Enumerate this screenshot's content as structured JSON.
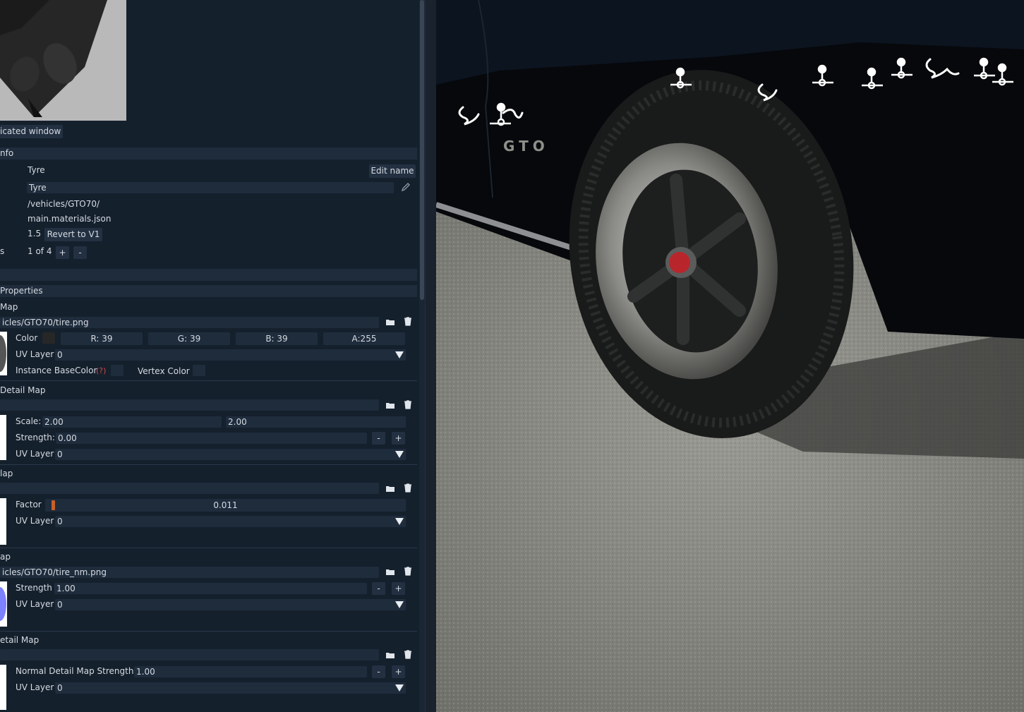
{
  "preview": {
    "window_label": "icated window"
  },
  "info": {
    "header": "nfo",
    "name_value": "Tyre",
    "edit_name_button": "Edit name",
    "name_input": "Tyre",
    "path": "/vehicles/GTO70/",
    "file": "main.materials.json",
    "version": "1.5",
    "revert_button": "Revert to V1",
    "stage_row_prefix": "s",
    "stage_count": "1 of 4",
    "stage_add": "+",
    "stage_remove": "-"
  },
  "properties": {
    "header": "Properties"
  },
  "base_color_map": {
    "header": " Map",
    "path": "icles/GTO70/tire.png",
    "color_label": "Color",
    "swatch_color": "#272727",
    "r": "R: 39",
    "g": "G: 39",
    "b": "B: 39",
    "a": "A:255",
    "uv_label": "UV Layer",
    "uv_value": "0",
    "instance_label": "Instance BaseColor",
    "help_mark": "(?)",
    "vertex_label": "Vertex Color"
  },
  "detail_map": {
    "header": " Detail Map",
    "path": "",
    "scale_label": "Scale:",
    "scale_x": "2.00",
    "scale_y": "2.00",
    "strength_label": "Strength:",
    "strength_value": "0.00",
    "minus": "-",
    "plus": "+",
    "uv_label": "UV Layer",
    "uv_value": "0"
  },
  "third_map": {
    "header": "lap",
    "path": "",
    "factor_label": "Factor",
    "factor_value": "0.011",
    "factor_level": 0.011,
    "uv_label": "UV Layer",
    "uv_value": "0"
  },
  "normal_map": {
    "header": "ap",
    "path": "icles/GTO70/tire_nm.png",
    "strength_label": "Strength",
    "strength_value": "1.00",
    "minus": "-",
    "plus": "+",
    "uv_label": "UV Layer",
    "uv_value": "0"
  },
  "normal_detail_map": {
    "header": "etail Map",
    "path": "",
    "strength_label": "Normal Detail Map Strength",
    "strength_value": "1.00",
    "minus": "-",
    "plus": "+",
    "uv_label": "UV Layer",
    "uv_value": "0"
  },
  "viewport": {
    "badge_text": "GTO"
  },
  "colors": {
    "panel_bg": "#15202d",
    "field_bg": "#1f2c3c",
    "accent_orange": "#c8602a",
    "help_red": "#d04848"
  }
}
